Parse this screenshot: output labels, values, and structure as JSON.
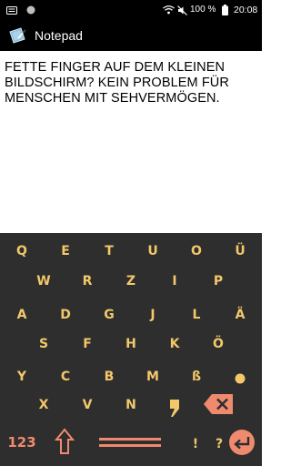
{
  "status_bar": {
    "time": "20:08",
    "battery_percent": "100 %",
    "icons": [
      "notification-icon",
      "status-circle-icon",
      "wifi-icon",
      "mute-icon",
      "battery-icon"
    ]
  },
  "action_bar": {
    "title": "Notepad",
    "icon": "notepad-app-icon"
  },
  "note": {
    "text": "FETTE FINGER AUF DEM KLEINEN\nBILDSCHIRM? KEIN PROBLEM FÜR\nMENSCHEN MIT SEHVERMÖGEN."
  },
  "keyboard": {
    "rows": [
      [
        "Q",
        "E",
        "T",
        "U",
        "O",
        "Ü"
      ],
      [
        "W",
        "R",
        "Z",
        "I",
        "P"
      ],
      [
        "A",
        "D",
        "G",
        "J",
        "L",
        "Ä"
      ],
      [
        "S",
        "F",
        "H",
        "K",
        "Ö"
      ],
      [
        "Y",
        "C",
        "B",
        "M",
        "ß"
      ],
      [
        "X",
        "V",
        "N"
      ]
    ],
    "numbers_label": "123",
    "punctuation": {
      "period": "•",
      "comma": ",",
      "exclaim": "!",
      "question": "?"
    },
    "colors": {
      "key_text": "#f2c86a",
      "accent": "#f08a6e",
      "background": "#2e2e2e"
    }
  }
}
